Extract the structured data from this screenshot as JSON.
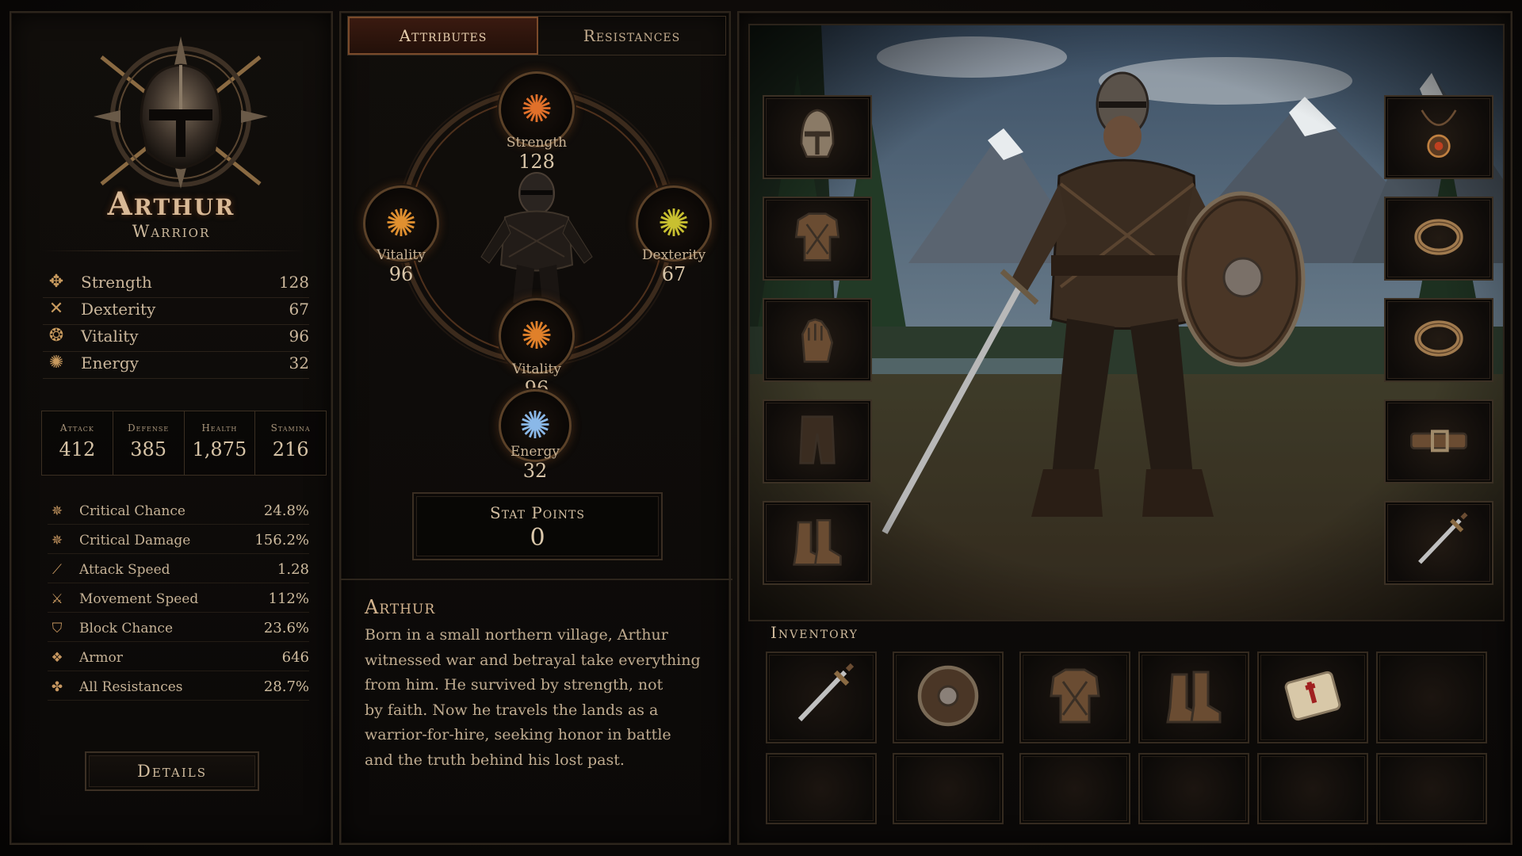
{
  "character": {
    "name": "Arthur",
    "class": "Warrior"
  },
  "attributes": [
    {
      "label": "Strength",
      "value": "128",
      "icon": "strength-icon",
      "glyph": "✥"
    },
    {
      "label": "Dexterity",
      "value": "67",
      "icon": "dexterity-icon",
      "glyph": "✕"
    },
    {
      "label": "Vitality",
      "value": "96",
      "icon": "vitality-icon",
      "glyph": "❂"
    },
    {
      "label": "Energy",
      "value": "32",
      "icon": "energy-icon",
      "glyph": "✺"
    }
  ],
  "combat": [
    {
      "label": "Attack",
      "value": "412"
    },
    {
      "label": "Defense",
      "value": "385"
    },
    {
      "label": "Health",
      "value": "1,875"
    },
    {
      "label": "Stamina",
      "value": "216"
    }
  ],
  "stats": [
    {
      "label": "Critical Chance",
      "value": "24.8%",
      "icon": "critical-chance-icon",
      "glyph": "✵"
    },
    {
      "label": "Critical Damage",
      "value": "156.2%",
      "icon": "critical-damage-icon",
      "glyph": "✵"
    },
    {
      "label": "Attack Speed",
      "value": "1.28",
      "icon": "attack-speed-icon",
      "glyph": "⟋"
    },
    {
      "label": "Movement Speed",
      "value": "112%",
      "icon": "movement-speed-icon",
      "glyph": "⚔"
    },
    {
      "label": "Block Chance",
      "value": "23.6%",
      "icon": "shield-icon",
      "glyph": "⛉"
    },
    {
      "label": "Armor",
      "value": "646",
      "icon": "armor-icon",
      "glyph": "❖"
    },
    {
      "label": "All Resistances",
      "value": "28.7%",
      "icon": "resistances-icon",
      "glyph": "✤"
    }
  ],
  "details_label": "Details",
  "tabs": [
    {
      "label": "Attributes",
      "active": true
    },
    {
      "label": "Resistances",
      "active": false
    }
  ],
  "wheel": {
    "top": {
      "label": "Strength",
      "value": "128",
      "color": "#e0702a"
    },
    "left": {
      "label": "Vitality",
      "value": "96",
      "color": "#e09030"
    },
    "right": {
      "label": "Dexterity",
      "value": "67",
      "color": "#c8c030"
    },
    "bottom": {
      "label": "Vitality",
      "value": "96",
      "color": "#e0802a"
    },
    "energy": {
      "label": "Energy",
      "value": "32",
      "color": "#8ab8e8"
    }
  },
  "stat_points": {
    "label": "Stat Points",
    "value": "0"
  },
  "bio": {
    "name": "Arthur",
    "lines": [
      "Born in a small northern village, Arthur",
      "witnessed war and betrayal take everything",
      "from him. He survived by strength, not",
      "by faith. Now he travels the lands as a",
      "warrior-for-hire, seeking honor in battle",
      "and the truth behind his lost past."
    ]
  },
  "equipment_left": [
    "helmet-icon",
    "chest-armor-icon",
    "gauntlets-icon",
    "leggings-icon",
    "boots-icon"
  ],
  "equipment_right": [
    "amulet-icon",
    "ring-icon",
    "ring-icon",
    "belt-icon",
    "sword-icon"
  ],
  "inventory_title": "Inventory",
  "inventory": [
    "sword-icon",
    "shield-icon",
    "chest-armor-icon",
    "boots-icon",
    "bandage-icon",
    "empty",
    "empty",
    "empty",
    "empty",
    "empty",
    "empty",
    "empty"
  ]
}
